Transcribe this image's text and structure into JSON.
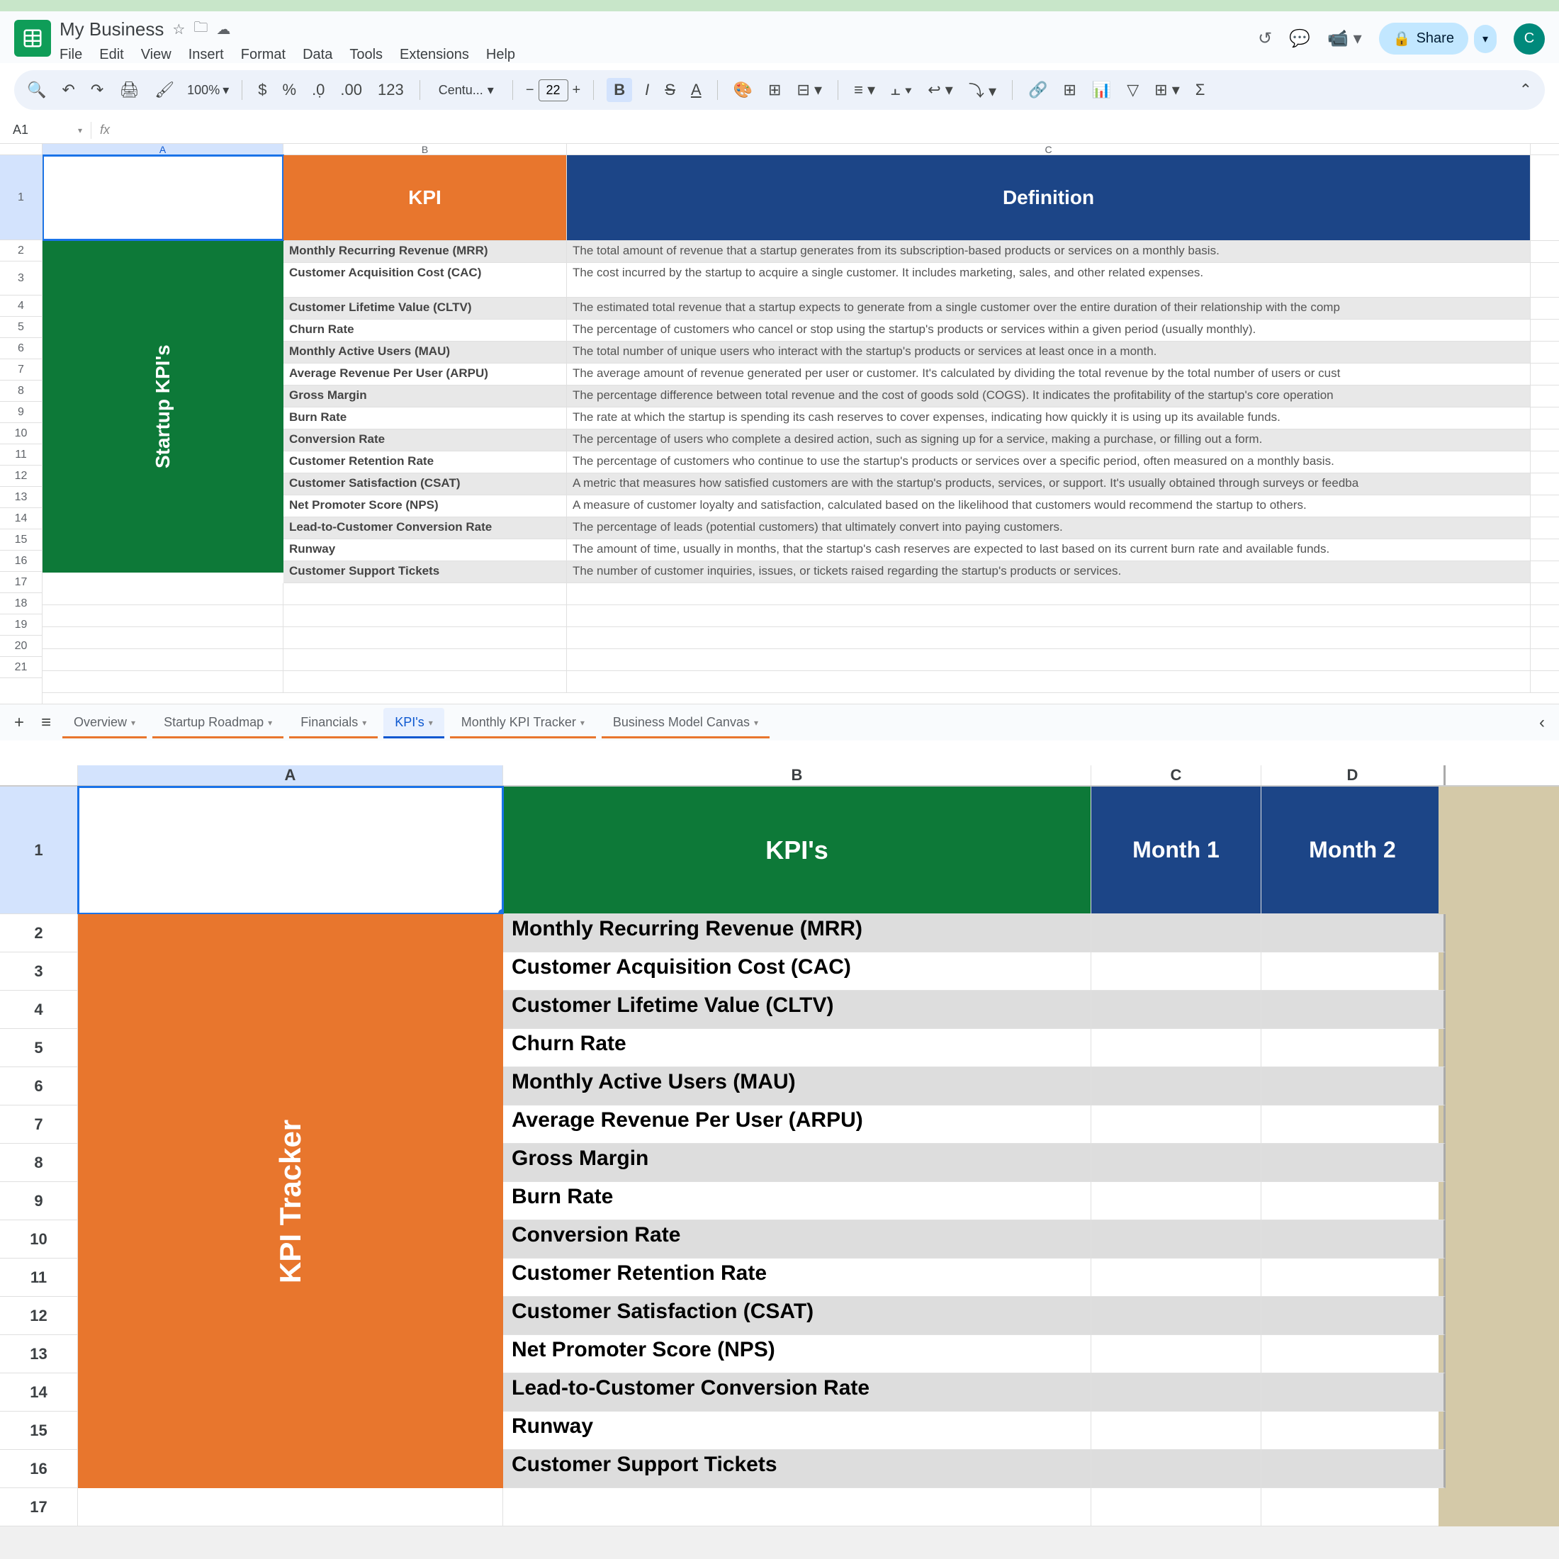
{
  "app": {
    "title": "My Business",
    "menus": [
      "File",
      "Edit",
      "View",
      "Insert",
      "Format",
      "Data",
      "Tools",
      "Extensions",
      "Help"
    ],
    "share": "Share",
    "avatar": "C",
    "zoom": "100%",
    "font": "Centu...",
    "font_size": "22",
    "name_box": "A1"
  },
  "top_sheet": {
    "col_labels": [
      "A",
      "B",
      "C"
    ],
    "header": {
      "a": "",
      "b": "KPI",
      "c": "Definition"
    },
    "vert_label": "Startup KPI's",
    "rows": [
      {
        "b": "Monthly Recurring Revenue (MRR)",
        "c": "The total amount of revenue that a startup generates from its subscription-based products or services on a monthly basis."
      },
      {
        "b": "Customer Acquisition Cost (CAC)",
        "c": "The cost incurred by the startup to acquire a single customer. It includes marketing, sales, and other related expenses."
      },
      {
        "b": "Customer Lifetime Value (CLTV)",
        "c": "The estimated total revenue that a startup expects to generate from a single customer over the entire duration of their relationship with the comp"
      },
      {
        "b": "Churn Rate",
        "c": "The percentage of customers who cancel or stop using the startup's products or services within a given period (usually monthly)."
      },
      {
        "b": "Monthly Active Users (MAU)",
        "c": "The total number of unique users who interact with the startup's products or services at least once in a month."
      },
      {
        "b": "Average Revenue Per User (ARPU)",
        "c": "The average amount of revenue generated per user or customer. It's calculated by dividing the total revenue by the total number of users or cust"
      },
      {
        "b": "Gross Margin",
        "c": "The percentage difference between total revenue and the cost of goods sold (COGS). It indicates the profitability of the startup's core operation"
      },
      {
        "b": "Burn Rate",
        "c": "The rate at which the startup is spending its cash reserves to cover expenses, indicating how quickly it is using up its available funds."
      },
      {
        "b": "Conversion Rate",
        "c": "The percentage of users who complete a desired action, such as signing up for a service, making a purchase, or filling out a form."
      },
      {
        "b": "Customer Retention Rate",
        "c": "The percentage of customers who continue to use the startup's products or services over a specific period, often measured on a monthly basis."
      },
      {
        "b": "Customer Satisfaction (CSAT)",
        "c": "A metric that measures how satisfied customers are with the startup's products, services, or support. It's usually obtained through surveys or feedba"
      },
      {
        "b": "Net Promoter Score (NPS)",
        "c": "A measure of customer loyalty and satisfaction, calculated based on the likelihood that customers would recommend the startup to others."
      },
      {
        "b": "Lead-to-Customer Conversion Rate",
        "c": "The percentage of leads (potential customers) that ultimately convert into paying customers."
      },
      {
        "b": "Runway",
        "c": "The amount of time, usually in months, that the startup's cash reserves are expected to last based on its current burn rate and available funds."
      },
      {
        "b": "Customer Support Tickets",
        "c": "The number of customer inquiries, issues, or tickets raised regarding the startup's products or services."
      }
    ],
    "tabs": [
      "Overview",
      "Startup Roadmap",
      "Financials",
      "KPI's",
      "Monthly KPI Tracker",
      "Business Model Canvas"
    ],
    "active_tab": 3
  },
  "bottom_sheet": {
    "col_labels": [
      "A",
      "B",
      "C",
      "D"
    ],
    "header": {
      "b": "KPI's",
      "c": "Month 1",
      "d": "Month 2"
    },
    "vert_label": "KPI Tracker",
    "rows": [
      "Monthly Recurring Revenue (MRR)",
      "Customer Acquisition Cost (CAC)",
      "Customer Lifetime Value (CLTV)",
      "Churn Rate",
      "Monthly Active Users (MAU)",
      "Average Revenue Per User (ARPU)",
      "Gross Margin",
      "Burn Rate",
      "Conversion Rate",
      "Customer Retention Rate",
      "Customer Satisfaction (CSAT)",
      "Net Promoter Score (NPS)",
      "Lead-to-Customer Conversion Rate",
      "Runway",
      "Customer Support Tickets"
    ]
  }
}
